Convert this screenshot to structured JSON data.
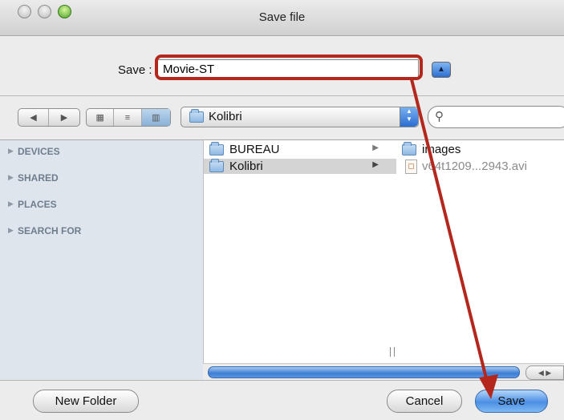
{
  "window": {
    "title": "Save file"
  },
  "save_row": {
    "label": "Save :",
    "filename_value": "Movie-ST",
    "expand_symbol": "▲"
  },
  "toolbar": {
    "back_symbol": "◀",
    "forward_symbol": "▶",
    "view_icon_symbol": "▦",
    "view_list_symbol": "≡",
    "view_column_symbol": "▥",
    "location_popup": "Kolibri",
    "search_value": ""
  },
  "sidebar": {
    "sections": [
      {
        "label": "DEVICES"
      },
      {
        "label": "SHARED"
      },
      {
        "label": "PLACES"
      },
      {
        "label": "SEARCH FOR"
      }
    ]
  },
  "column1": {
    "items": [
      {
        "name": "BUREAU",
        "type": "folder",
        "selected": false
      },
      {
        "name": "Kolibri",
        "type": "folder",
        "selected": true
      }
    ]
  },
  "column2": {
    "items": [
      {
        "name": "images",
        "type": "folder"
      },
      {
        "name": "v64t1209...2943.avi",
        "type": "file"
      }
    ]
  },
  "footer": {
    "new_folder_label": "New Folder",
    "cancel_label": "Cancel",
    "save_label": "Save"
  },
  "colors": {
    "annotation_red": "#b3271c",
    "selection_blue": "#4b8fe3"
  }
}
